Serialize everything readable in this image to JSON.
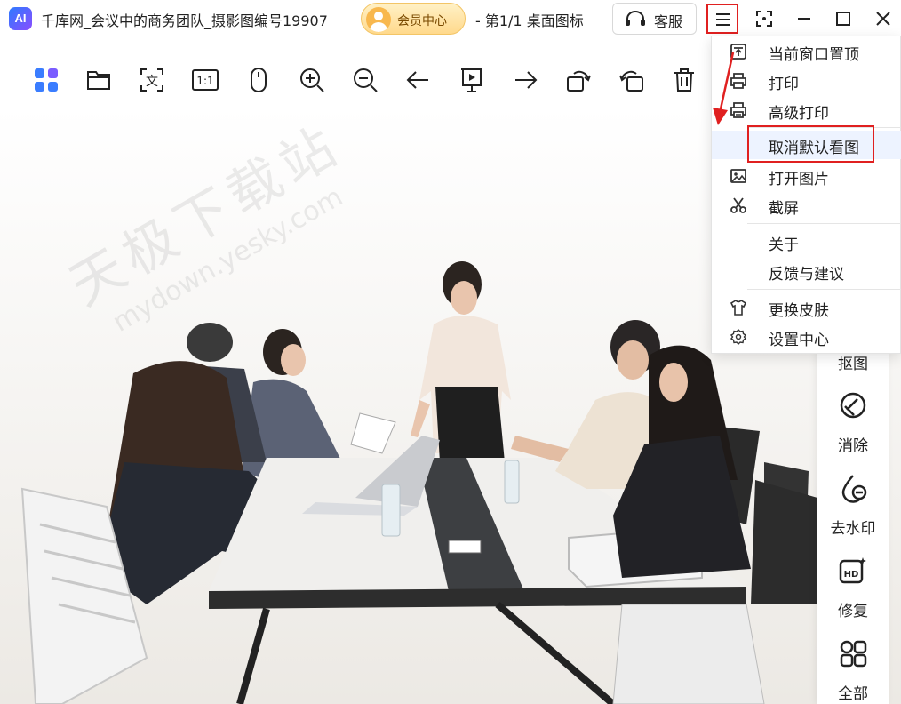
{
  "window": {
    "logo_text": "AI",
    "title": "千库网_会议中的商务团队_摄影图编号19907",
    "title_suffix": "- 第1/1 桌面图标",
    "member_center": "会员中心",
    "customer_service": "客服"
  },
  "toolbar": [
    {
      "name": "thumbnails-button",
      "icon": "grid-icon"
    },
    {
      "name": "open-folder-button",
      "icon": "folder-icon"
    },
    {
      "name": "ocr-text-button",
      "icon": "text-scan-icon"
    },
    {
      "name": "actual-size-button",
      "icon": "one-to-one-icon",
      "label": "1:1"
    },
    {
      "name": "mouse-mode-button",
      "icon": "mouse-icon"
    },
    {
      "name": "zoom-in-button",
      "icon": "zoom-in-icon"
    },
    {
      "name": "zoom-out-button",
      "icon": "zoom-out-icon"
    },
    {
      "name": "previous-button",
      "icon": "arrow-left-icon"
    },
    {
      "name": "slideshow-button",
      "icon": "presentation-icon"
    },
    {
      "name": "next-button",
      "icon": "arrow-right-icon"
    },
    {
      "name": "rotate-left-button",
      "icon": "rotate-left-icon"
    },
    {
      "name": "rotate-right-button",
      "icon": "rotate-right-icon"
    },
    {
      "name": "delete-button",
      "icon": "trash-icon"
    }
  ],
  "watermark": {
    "cn": "天极下载站",
    "en": "mydown.yesky.com"
  },
  "menu": {
    "items": [
      {
        "label": "当前窗口置顶",
        "icon": "pin-top-icon"
      },
      {
        "label": "打印",
        "icon": "printer-icon"
      },
      {
        "label": "高级打印",
        "icon": "advanced-printer-icon"
      },
      {
        "label": "取消默认看图",
        "icon": "",
        "highlighted": true
      },
      {
        "label": "打开图片",
        "icon": "image-icon"
      },
      {
        "label": "截屏",
        "icon": "scissors-icon"
      },
      {
        "label": "关于",
        "icon": ""
      },
      {
        "label": "反馈与建议",
        "icon": ""
      },
      {
        "label": "更换皮肤",
        "icon": "shirt-icon"
      },
      {
        "label": "设置中心",
        "icon": "settings-gear-icon"
      }
    ]
  },
  "side_tools": [
    {
      "label": "抠图",
      "icon": "cutout-icon"
    },
    {
      "label": "消除",
      "icon": "eraser-icon"
    },
    {
      "label": "去水印",
      "icon": "watermark-remove-icon"
    },
    {
      "label": "修复",
      "icon": "hd-repair-icon"
    },
    {
      "label": "全部",
      "icon": "all-apps-icon"
    }
  ],
  "colors": {
    "accent": "#2d7bff",
    "annotation_red": "#e02020",
    "member_gold": "#ffd98c"
  }
}
